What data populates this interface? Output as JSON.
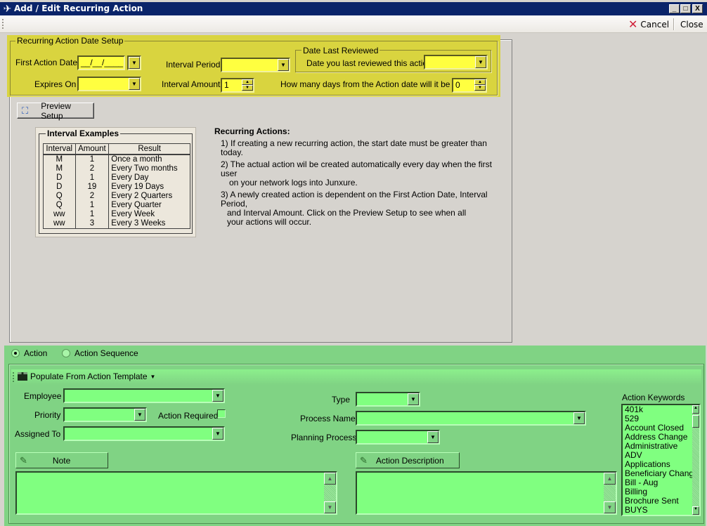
{
  "window": {
    "title": "Add / Edit Recurring Action",
    "controls": {
      "minimize": "_",
      "maximize": "□",
      "close": "X"
    }
  },
  "toolbar": {
    "cancel_label": "Cancel",
    "close_label": "Close"
  },
  "date_setup": {
    "group_label": "Recurring Action Date Setup",
    "first_action_date_label": "First Action Date",
    "first_action_date_value": "__/__/____",
    "expires_on_label": "Expires On",
    "expires_on_value": "",
    "interval_period_label": "Interval Period",
    "interval_period_value": "",
    "interval_amount_label": "Interval Amount",
    "interval_amount_value": "1",
    "date_last_reviewed": {
      "group_label": "Date Last Reviewed",
      "label": "Date you last reviewed this action.",
      "value": ""
    },
    "due_days_label": "How many days from the Action date will it be due",
    "due_days_value": "0",
    "highlight_color": "#d9d43f"
  },
  "preview_button_label": "Preview Setup",
  "interval_examples": {
    "title": "Interval Examples",
    "headers": [
      "Interval",
      "Amount",
      "Result"
    ],
    "rows": [
      [
        "M",
        "1",
        "Once a month"
      ],
      [
        "M",
        "2",
        "Every Two months"
      ],
      [
        "D",
        "1",
        "Every Day"
      ],
      [
        "D",
        "19",
        "Every 19 Days"
      ],
      [
        "Q",
        "2",
        "Every 2 Quarters"
      ],
      [
        "Q",
        "1",
        "Every Quarter"
      ],
      [
        "ww",
        "1",
        "Every Week"
      ],
      [
        "ww",
        "3",
        "Every 3 Weeks"
      ]
    ]
  },
  "recurring_notes": {
    "heading": "Recurring Actions:",
    "items": [
      {
        "first": "1) If creating a new recurring action, the start date must be greater than today.",
        "rest": ""
      },
      {
        "first": "2) The actual action wil be created automatically every day when the first user",
        "rest": "on your network logs into Junxure."
      },
      {
        "first": "3) A newly created action is dependent on the First Action Date, Interval Period,",
        "rest": "and Interval Amount.  Click on the Preview Setup to see when all your actions will occur."
      }
    ]
  },
  "action_panel": {
    "highlight_color": "#80d384",
    "radio_action": "Action",
    "radio_sequence": "Action Sequence",
    "selected": "Action",
    "template_button": "Populate From Action Template",
    "employee_label": "Employee",
    "employee_value": "",
    "priority_label": "Priority",
    "priority_value": "",
    "action_required_label": "Action Required",
    "action_required_checked": false,
    "assigned_to_label": "Assigned To",
    "assigned_to_value": "",
    "type_label": "Type",
    "type_value": "",
    "process_name_label": "Process Name",
    "process_name_value": "",
    "planning_process_label": "Planning Process",
    "planning_process_value": "",
    "note_button": "Note",
    "note_value": "",
    "description_button": "Action Description",
    "description_value": "",
    "keywords_label": "Action Keywords",
    "keywords": [
      "401k",
      "529",
      "Account Closed",
      "Address Change",
      "Administrative",
      "ADV",
      "Applications",
      "Beneficiary Change",
      "Bill - Aug",
      "Billing",
      "Brochure Sent",
      "BUYS"
    ]
  }
}
